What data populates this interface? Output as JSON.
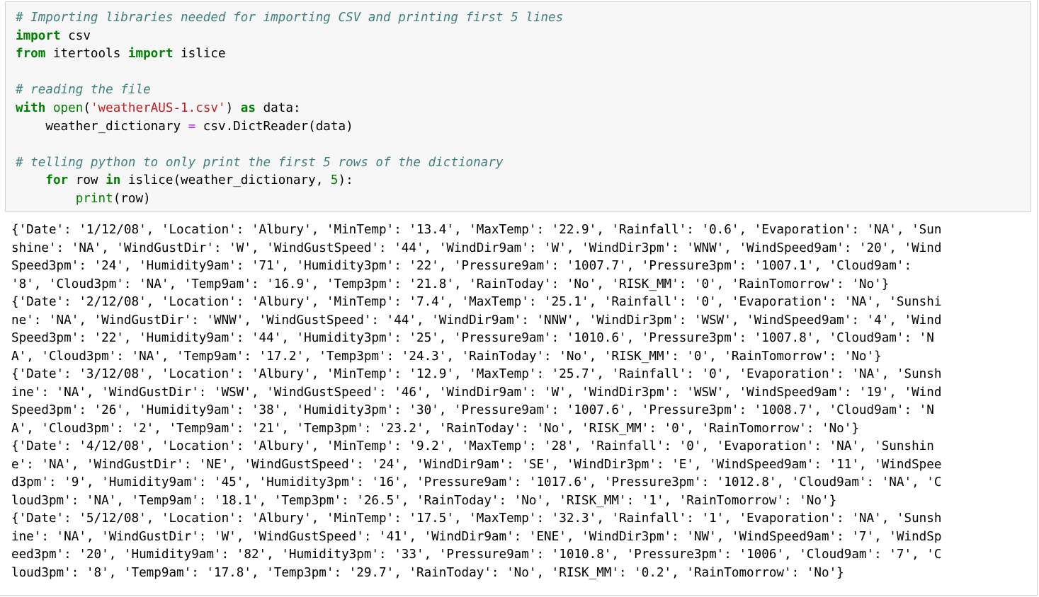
{
  "input_cell": {
    "lines": [
      [
        {
          "t": "cm",
          "s": "# Importing libraries needed for importing CSV and printing first 5 lines"
        }
      ],
      [
        {
          "t": "kw",
          "s": "import"
        },
        {
          "t": "",
          "s": " csv"
        }
      ],
      [
        {
          "t": "kw",
          "s": "from"
        },
        {
          "t": "",
          "s": " itertools "
        },
        {
          "t": "kw",
          "s": "import"
        },
        {
          "t": "",
          "s": " islice"
        }
      ],
      [
        {
          "t": "",
          "s": ""
        }
      ],
      [
        {
          "t": "cm",
          "s": "# reading the file"
        }
      ],
      [
        {
          "t": "kw",
          "s": "with"
        },
        {
          "t": "",
          "s": " "
        },
        {
          "t": "bi",
          "s": "open"
        },
        {
          "t": "",
          "s": "("
        },
        {
          "t": "st",
          "s": "'weatherAUS-1.csv'"
        },
        {
          "t": "",
          "s": ") "
        },
        {
          "t": "kw",
          "s": "as"
        },
        {
          "t": "",
          "s": " data:"
        }
      ],
      [
        {
          "t": "",
          "s": "    weather_dictionary "
        },
        {
          "t": "op",
          "s": "="
        },
        {
          "t": "",
          "s": " csv.DictReader(data)"
        }
      ],
      [
        {
          "t": "",
          "s": ""
        }
      ],
      [
        {
          "t": "cm",
          "s": "# telling python to only print the first 5 rows of the dictionary"
        }
      ],
      [
        {
          "t": "",
          "s": "    "
        },
        {
          "t": "kw",
          "s": "for"
        },
        {
          "t": "",
          "s": " row "
        },
        {
          "t": "kw",
          "s": "in"
        },
        {
          "t": "",
          "s": " islice(weather_dictionary, "
        },
        {
          "t": "nu",
          "s": "5"
        },
        {
          "t": "",
          "s": "):"
        }
      ],
      [
        {
          "t": "",
          "s": "        "
        },
        {
          "t": "bi",
          "s": "print"
        },
        {
          "t": "",
          "s": "(row)"
        }
      ]
    ]
  },
  "output_cell": {
    "lines": [
      "{'Date': '1/12/08', 'Location': 'Albury', 'MinTemp': '13.4', 'MaxTemp': '22.9', 'Rainfall': '0.6', 'Evaporation': 'NA', 'Sun",
      "shine': 'NA', 'WindGustDir': 'W', 'WindGustSpeed': '44', 'WindDir9am': 'W', 'WindDir3pm': 'WNW', 'WindSpeed9am': '20', 'Wind",
      "Speed3pm': '24', 'Humidity9am': '71', 'Humidity3pm': '22', 'Pressure9am': '1007.7', 'Pressure3pm': '1007.1', 'Cloud9am':",
      "'8', 'Cloud3pm': 'NA', 'Temp9am': '16.9', 'Temp3pm': '21.8', 'RainToday': 'No', 'RISK_MM': '0', 'RainTomorrow': 'No'}",
      "{'Date': '2/12/08', 'Location': 'Albury', 'MinTemp': '7.4', 'MaxTemp': '25.1', 'Rainfall': '0', 'Evaporation': 'NA', 'Sunshi",
      "ne': 'NA', 'WindGustDir': 'WNW', 'WindGustSpeed': '44', 'WindDir9am': 'NNW', 'WindDir3pm': 'WSW', 'WindSpeed9am': '4', 'Wind",
      "Speed3pm': '22', 'Humidity9am': '44', 'Humidity3pm': '25', 'Pressure9am': '1010.6', 'Pressure3pm': '1007.8', 'Cloud9am': 'N",
      "A', 'Cloud3pm': 'NA', 'Temp9am': '17.2', 'Temp3pm': '24.3', 'RainToday': 'No', 'RISK_MM': '0', 'RainTomorrow': 'No'}",
      "{'Date': '3/12/08', 'Location': 'Albury', 'MinTemp': '12.9', 'MaxTemp': '25.7', 'Rainfall': '0', 'Evaporation': 'NA', 'Sunsh",
      "ine': 'NA', 'WindGustDir': 'WSW', 'WindGustSpeed': '46', 'WindDir9am': 'W', 'WindDir3pm': 'WSW', 'WindSpeed9am': '19', 'Wind",
      "Speed3pm': '26', 'Humidity9am': '38', 'Humidity3pm': '30', 'Pressure9am': '1007.6', 'Pressure3pm': '1008.7', 'Cloud9am': 'N",
      "A', 'Cloud3pm': '2', 'Temp9am': '21', 'Temp3pm': '23.2', 'RainToday': 'No', 'RISK_MM': '0', 'RainTomorrow': 'No'}",
      "{'Date': '4/12/08', 'Location': 'Albury', 'MinTemp': '9.2', 'MaxTemp': '28', 'Rainfall': '0', 'Evaporation': 'NA', 'Sunshin",
      "e': 'NA', 'WindGustDir': 'NE', 'WindGustSpeed': '24', 'WindDir9am': 'SE', 'WindDir3pm': 'E', 'WindSpeed9am': '11', 'WindSpee",
      "d3pm': '9', 'Humidity9am': '45', 'Humidity3pm': '16', 'Pressure9am': '1017.6', 'Pressure3pm': '1012.8', 'Cloud9am': 'NA', 'C",
      "loud3pm': 'NA', 'Temp9am': '18.1', 'Temp3pm': '26.5', 'RainToday': 'No', 'RISK_MM': '1', 'RainTomorrow': 'No'}",
      "{'Date': '5/12/08', 'Location': 'Albury', 'MinTemp': '17.5', 'MaxTemp': '32.3', 'Rainfall': '1', 'Evaporation': 'NA', 'Sunsh",
      "ine': 'NA', 'WindGustDir': 'W', 'WindGustSpeed': '41', 'WindDir9am': 'ENE', 'WindDir3pm': 'NW', 'WindSpeed9am': '7', 'WindSp",
      "eed3pm': '20', 'Humidity9am': '82', 'Humidity3pm': '33', 'Pressure9am': '1010.8', 'Pressure3pm': '1006', 'Cloud9am': '7', 'C",
      "loud3pm': '8', 'Temp9am': '17.8', 'Temp3pm': '29.7', 'RainToday': 'No', 'RISK_MM': '0.2', 'RainTomorrow': 'No'}"
    ]
  },
  "colors": {
    "comment": "#408080",
    "keyword": "#008000",
    "string": "#BA2121",
    "operator": "#AA22FF",
    "input_background": "#f7f7f7",
    "border": "#cfcfcf"
  }
}
